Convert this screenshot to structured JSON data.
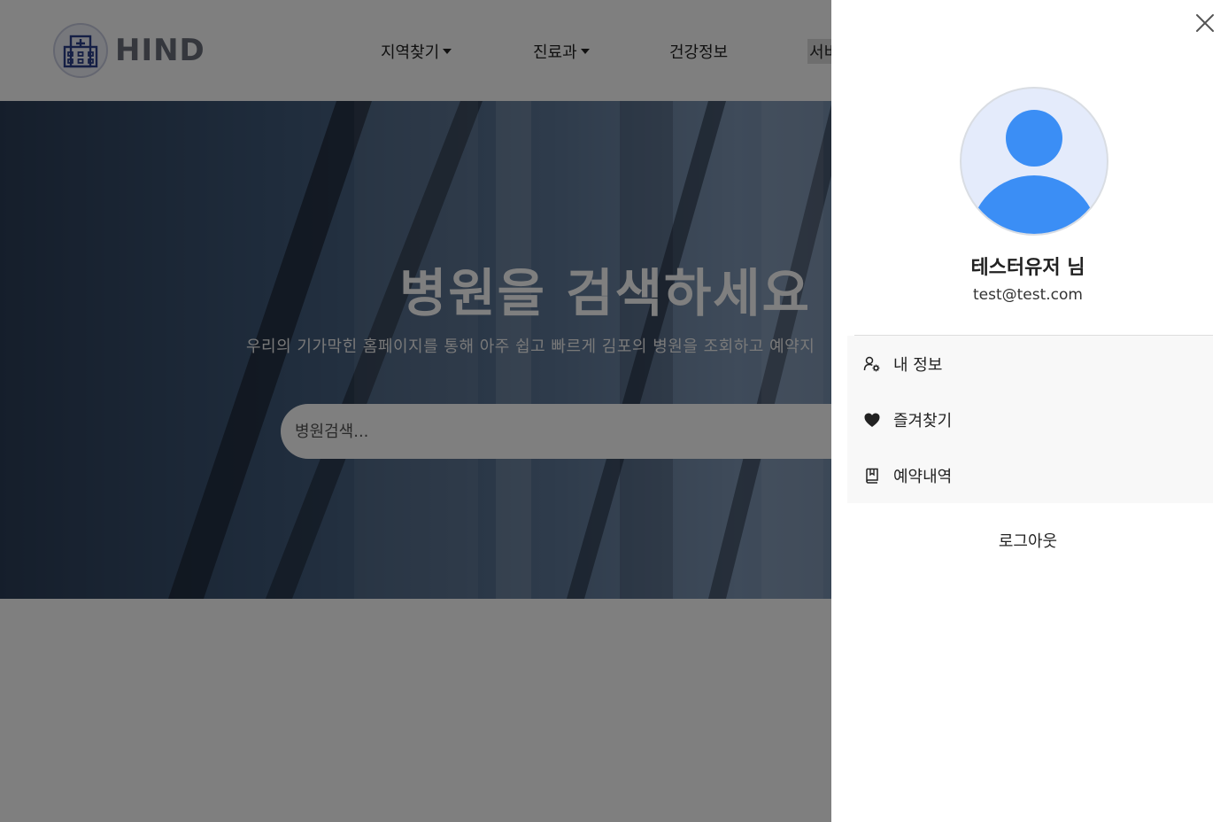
{
  "header": {
    "logo_text": "HIND",
    "nav": [
      {
        "label": "지역찾기",
        "has_dropdown": true
      },
      {
        "label": "진료과",
        "has_dropdown": true
      },
      {
        "label": "건강정보",
        "has_dropdown": false
      },
      {
        "label": "서비",
        "has_dropdown": false
      }
    ]
  },
  "hero": {
    "title": "병원을 검색하세요",
    "subtitle": "우리의 기가막힌 홈페이지를 통해 아주 쉽고 빠르게 김포의 병원을 조회하고 예약지",
    "search_placeholder": "병원검색..."
  },
  "drawer": {
    "close_icon": "close-icon",
    "user": {
      "name": "테스터유저 님",
      "email": "test@test.com"
    },
    "menu": [
      {
        "label": "내 정보",
        "icon": "user-gear-icon"
      },
      {
        "label": "즐겨찾기",
        "icon": "heart-icon"
      },
      {
        "label": "예약내역",
        "icon": "bookmark-book-icon"
      }
    ],
    "logout_label": "로그아웃"
  },
  "colors": {
    "avatar_bg": "#e4ebfb",
    "avatar_figure": "#3b8ef5",
    "overlay": "rgba(0,0,0,0.5)"
  }
}
